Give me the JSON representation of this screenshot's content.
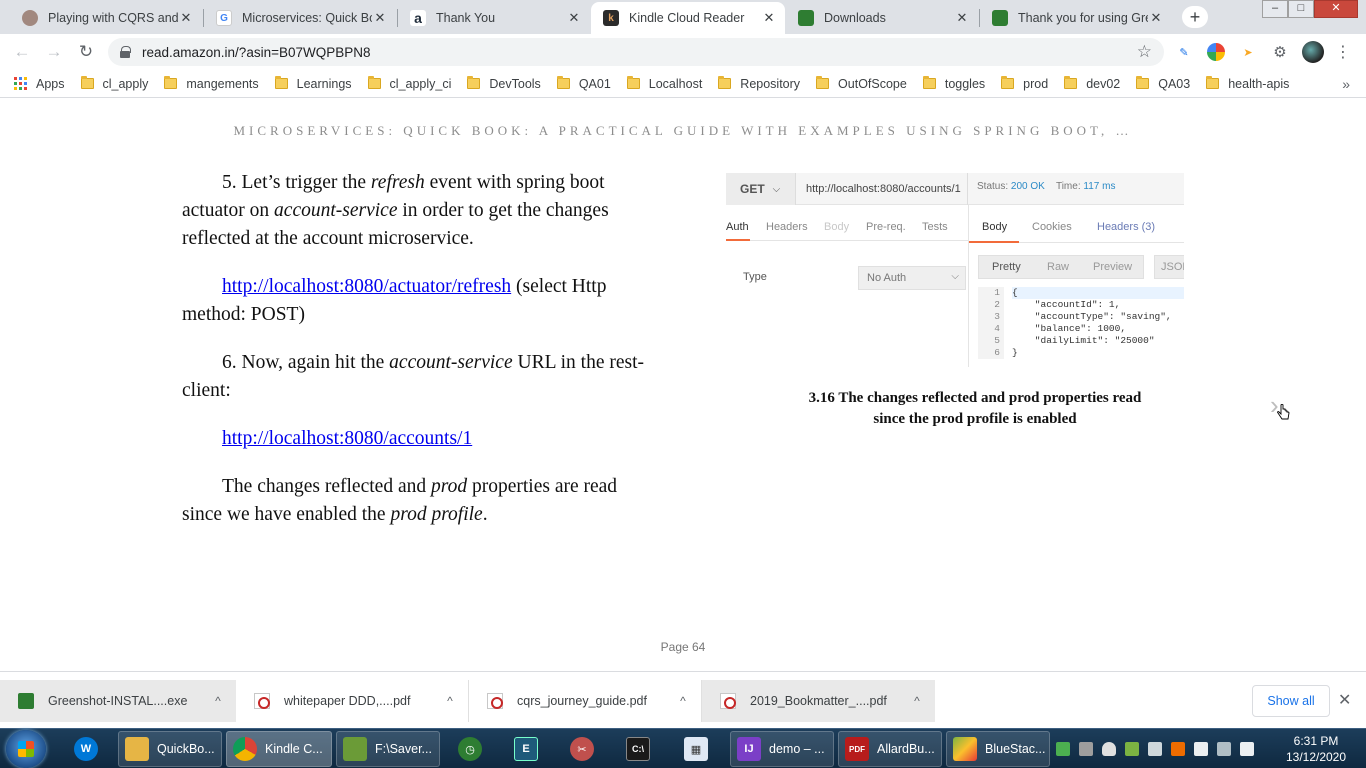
{
  "browser": {
    "tabs": [
      {
        "title": "Playing with CQRS and E",
        "favicon": "avatar-icon",
        "color": "#a1887f"
      },
      {
        "title": "Microservices: Quick Boo",
        "favicon": "google-icon",
        "color": "#4285f4"
      },
      {
        "title": "Thank You",
        "favicon": "amazon-icon",
        "color": "#232f3e"
      },
      {
        "title": "Kindle Cloud Reader",
        "favicon": "kindle-icon",
        "color": "#8d5a2b",
        "active": true
      },
      {
        "title": "Downloads",
        "favicon": "greenshot-icon",
        "color": "#2e7d32"
      },
      {
        "title": "Thank you for using Gree",
        "favicon": "greenshot-icon",
        "color": "#2e7d32"
      }
    ],
    "window_controls": {
      "minimize": "–",
      "maximize": "□",
      "close": "✕"
    },
    "new_tab": "+",
    "close_glyph": "✕",
    "url": "read.amazon.in/?asin=B07WQPBPN8",
    "bookmarks": [
      {
        "label": "Apps",
        "icon": "apps-grid-icon"
      },
      {
        "label": "cl_apply"
      },
      {
        "label": "mangements"
      },
      {
        "label": "Learnings"
      },
      {
        "label": "cl_apply_ci"
      },
      {
        "label": "DevTools"
      },
      {
        "label": "QA01"
      },
      {
        "label": "Localhost"
      },
      {
        "label": "Repository"
      },
      {
        "label": "OutOfScope"
      },
      {
        "label": "toggles"
      },
      {
        "label": "prod"
      },
      {
        "label": "dev02"
      },
      {
        "label": "QA03"
      },
      {
        "label": "health-apis"
      }
    ],
    "bookmarks_more": "»"
  },
  "reader": {
    "book_title": "MICROSERVICES: QUICK BOOK: A PRACTICAL GUIDE WITH EXAMPLES USING SPRING BOOT, …",
    "p1_a": "5. Let’s trigger the ",
    "p1_em1": "refresh",
    "p1_b": " event with spring boot actuator on ",
    "p1_em2": "account-service",
    "p1_c": " in order to get the changes reflected at the account microservice.",
    "link1": "http://localhost:8080/actuator/refresh",
    "p2_tail": " (select Http method: POST)",
    "p3_a": "6. Now, again hit the ",
    "p3_em": "account-service",
    "p3_b": " URL in the rest-client:",
    "link2": "http://localhost:8080/accounts/1",
    "p4_a": "The changes reflected and ",
    "p4_em1": "prod",
    "p4_b": " properties are read since we have enabled the ",
    "p4_em2": "prod profile",
    "p4_c": ".",
    "caption_line1": "3.16 The changes reflected and prod properties read",
    "caption_line2": "since the prod profile is enabled",
    "next_glyph": "›",
    "page_label": "Page 64"
  },
  "figure": {
    "method": "GET",
    "url": "http://localhost:8080/accounts/1",
    "status_label": "Status:",
    "status_value": "200 OK",
    "time_label": "Time:",
    "time_value": "117 ms",
    "req_tabs": [
      "Auth",
      "Headers",
      "Body",
      "Pre-req.",
      "Tests"
    ],
    "resp_tabs": [
      "Body",
      "Cookies",
      "Headers (3)"
    ],
    "type_label": "Type",
    "auth_value": "No Auth",
    "views": [
      "Pretty",
      "Raw",
      "Preview"
    ],
    "json_btn": "JSON",
    "code_lines": [
      {
        "n": "1",
        "t": "{"
      },
      {
        "n": "2",
        "t": "    \"accountId\": 1,"
      },
      {
        "n": "3",
        "t": "    \"accountType\": \"saving\","
      },
      {
        "n": "4",
        "t": "    \"balance\": 1000,"
      },
      {
        "n": "5",
        "t": "    \"dailyLimit\": \"25000\""
      },
      {
        "n": "6",
        "t": "}"
      }
    ]
  },
  "downloads": [
    {
      "name": "Greenshot-INSTAL....exe",
      "type": "exe"
    },
    {
      "name": "whitepaper DDD,....pdf",
      "type": "pdf"
    },
    {
      "name": "cqrs_journey_guide.pdf",
      "type": "pdf"
    },
    {
      "name": "2019_Bookmatter_....pdf",
      "type": "pdf"
    }
  ],
  "downloads_caret": "^",
  "show_all": "Show all",
  "shelf_close": "✕",
  "taskbar": {
    "items": [
      {
        "label": "",
        "icon": "edge-icon",
        "color": "#0078d7"
      },
      {
        "label": "QuickBo...",
        "icon": "folder-icon",
        "color": "#e6b545"
      },
      {
        "label": "Kindle C...",
        "icon": "chrome-icon",
        "color": "#db4437",
        "active": true
      },
      {
        "label": "F:\\Saver...",
        "icon": "notepad-icon",
        "color": "#6b9b37"
      },
      {
        "label": "",
        "icon": "clock-app-icon",
        "color": "#2e7d32"
      },
      {
        "label": "",
        "icon": "editor-icon",
        "color": "#1e5a7a"
      },
      {
        "label": "",
        "icon": "snipping-icon",
        "color": "#c0504d"
      },
      {
        "label": "",
        "icon": "cmd-icon",
        "color": "#1a1a1a"
      },
      {
        "label": "",
        "icon": "paint-icon",
        "color": "#4a78b5"
      },
      {
        "label": "demo – ...",
        "icon": "intellij-icon",
        "color": "#7b3fc7"
      },
      {
        "label": "AllardBu...",
        "icon": "pdf-reader-icon",
        "color": "#b71c1c"
      },
      {
        "label": "BlueStac...",
        "icon": "bluestacks-icon",
        "color": "#7cb342"
      }
    ],
    "tray_icons": [
      "greenshot-tray-icon",
      "network-icon",
      "shield-icon",
      "bluestacks-tray-icon",
      "keyboard-icon",
      "volume-icon",
      "flag-icon",
      "monitor-icon",
      "speaker-icon"
    ],
    "time": "6:31 PM",
    "date": "13/12/2020"
  }
}
